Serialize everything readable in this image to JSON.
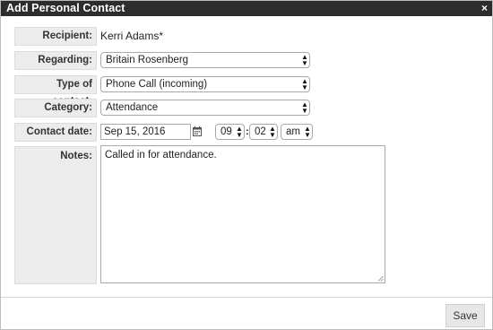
{
  "dialog": {
    "title": "Add Personal Contact",
    "close_glyph": "×"
  },
  "form": {
    "recipient": {
      "label": "Recipient:",
      "value": "Kerri Adams*"
    },
    "regarding": {
      "label": "Regarding:",
      "value": "Britain Rosenberg"
    },
    "type_of_contact": {
      "label": "Type of contact:",
      "value": "Phone Call (incoming)"
    },
    "category": {
      "label": "Category:",
      "value": "Attendance"
    },
    "contact_date": {
      "label": "Contact date:",
      "date": "Sep 15, 2016",
      "hour": "09",
      "minute": "02",
      "ampm": "am",
      "separator": ":"
    },
    "notes": {
      "label": "Notes:",
      "value": "Called in for attendance."
    }
  },
  "footer": {
    "save_label": "Save"
  },
  "icons": {
    "calendar": "calendar-icon",
    "select_arrows": "updown-arrows-icon",
    "close": "close-icon",
    "resize": "resize-grip-icon"
  },
  "colors": {
    "titlebar_bg": "#2d2d2d",
    "label_bg": "#ececec",
    "button_bg": "#e7e7e7"
  }
}
